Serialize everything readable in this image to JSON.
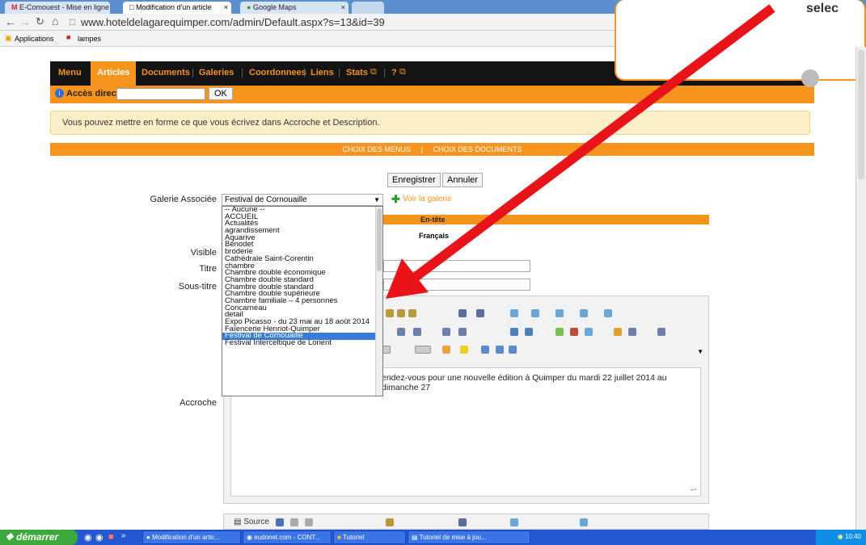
{
  "browser": {
    "tabs": [
      {
        "label": "E-Comouest - Mise en ligne d"
      },
      {
        "label": "Modification d'un article"
      },
      {
        "label": "Google Maps"
      }
    ],
    "close": "×",
    "url": "www.hoteldelagarequimper.com/admin/Default.aspx?s=13&id=39",
    "bookmarks": [
      {
        "label": "Applications"
      },
      {
        "label": "lampes"
      }
    ]
  },
  "nav": {
    "items": [
      "Menu",
      "Articles",
      "Documents",
      "Galeries",
      "Coordonnees",
      "Liens",
      "Stats",
      "?"
    ],
    "active": "Articles"
  },
  "acces": {
    "label": "Accès direct",
    "ok": "OK"
  },
  "info": "Vous pouvez mettre en forme ce que vous écrivez dans Accroche et Description.",
  "choix": {
    "menus": "CHOIX DES MENUS",
    "sep": "|",
    "documents": "CHOIX DES DOCUMENTS"
  },
  "form": {
    "enregistrer": "Enregistrer",
    "annuler": "Annuler",
    "galerie_label": "Galerie Associée",
    "galerie_value": "Festival de Cornouaille",
    "voir_galerie": "Voir la galerie",
    "entete": "En-tête",
    "francais": "Français",
    "visible": "Visible",
    "titre": "Titre",
    "sous_titre": "Sous-titre",
    "accroche": "Accroche",
    "editor_text": "endez-vous pour une nouvelle édition à Quimper du mardi 22 juillet 2014 au dimanche 27",
    "source": "Source"
  },
  "dropdown": {
    "options": [
      "-- Aucune --",
      "ACCUEIL",
      "Actualités",
      "agrandissement",
      "Aquarive",
      "Bénodet",
      "broderie",
      "Cathédrale Saint-Corentin",
      "chambre",
      "Chambre double économique",
      "Chambre double standard",
      "Chambre double standard",
      "Chambre double supérieure",
      "Chambre familiale – 4 personnes",
      "Concarneau",
      "detail",
      "Expo Picasso - du 23 mai au 18 août 2014",
      "Faïencerie Henriot-Quimper",
      "Festival de Cornouaille",
      "Festival Interceltique de Lorient"
    ],
    "selected_index": 18
  },
  "callout": "selec",
  "taskbar": {
    "start": "démarrer",
    "items": [
      "Modification d'un artic...",
      "eudonet.com - CONT...",
      "Tutoriel",
      "Tutoriel de mise à jou..."
    ],
    "clock": "10:40"
  },
  "colors": {
    "orange": "#f7941d",
    "navbg": "#141414",
    "arrow": "#e8141a"
  }
}
